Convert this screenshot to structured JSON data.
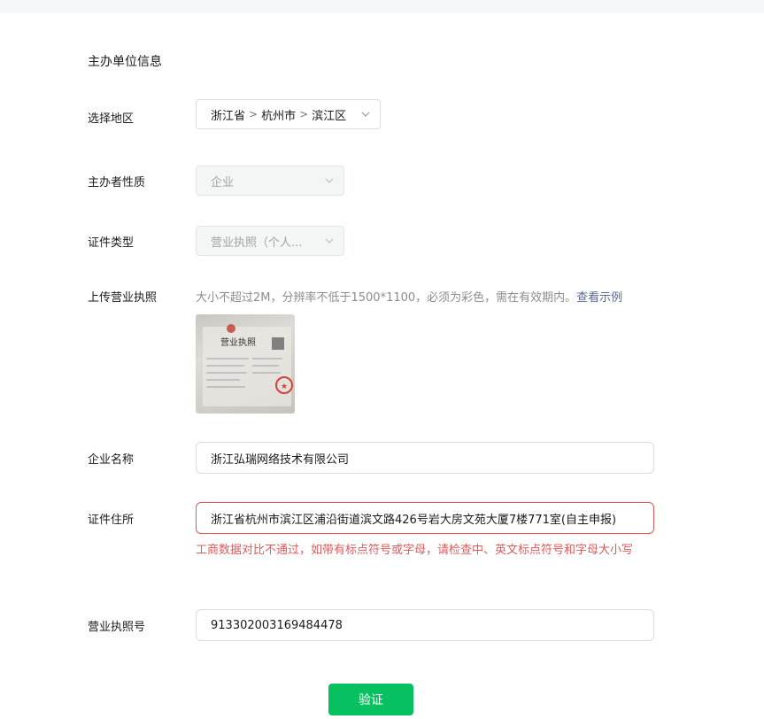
{
  "section": {
    "title": "主办单位信息"
  },
  "region": {
    "label": "选择地区",
    "province": "浙江省",
    "city": "杭州市",
    "district": "滨江区",
    "separator": ">"
  },
  "organizer_type": {
    "label": "主办者性质",
    "value": "企业"
  },
  "certificate_type": {
    "label": "证件类型",
    "value": "营业执照（个人..."
  },
  "license_upload": {
    "label": "上传营业执照",
    "hint": "大小不超过2M，分辨率不低于1500*1100，必须为彩色，需在有效期内。",
    "example_link": "查看示例",
    "thumbnail_title": "营业执照"
  },
  "company_name": {
    "label": "企业名称",
    "value": "浙江弘瑞网络技术有限公司"
  },
  "certificate_address": {
    "label": "证件住所",
    "value": "浙江省杭州市滨江区浦沿街道滨文路426号岩大房文苑大厦7楼771室(自主申报)",
    "error": "工商数据对比不通过，如带有标点符号或字母，请检查中、英文标点符号和字母大小写"
  },
  "license_number": {
    "label": "营业执照号",
    "value": "913302003169484478"
  },
  "submit": {
    "label": "验证"
  },
  "colors": {
    "accent": "#07c160",
    "error": "#e05a5a",
    "link": "#576b95"
  },
  "icons": {
    "dropdown": "chevron-down-icon",
    "seal": "red-seal"
  }
}
